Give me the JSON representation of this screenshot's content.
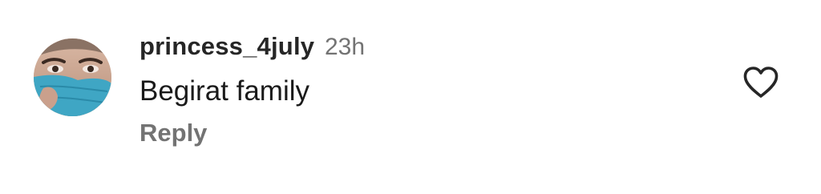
{
  "comment": {
    "username": "princess_4july",
    "time": "23h",
    "text": "Begirat family",
    "reply_label": "Reply"
  },
  "icons": {
    "like": "heart-outline-icon"
  },
  "colors": {
    "username": "#262626",
    "meta": "#737373",
    "text": "#1a1a1a",
    "icon": "#262626",
    "background": "#ffffff"
  }
}
